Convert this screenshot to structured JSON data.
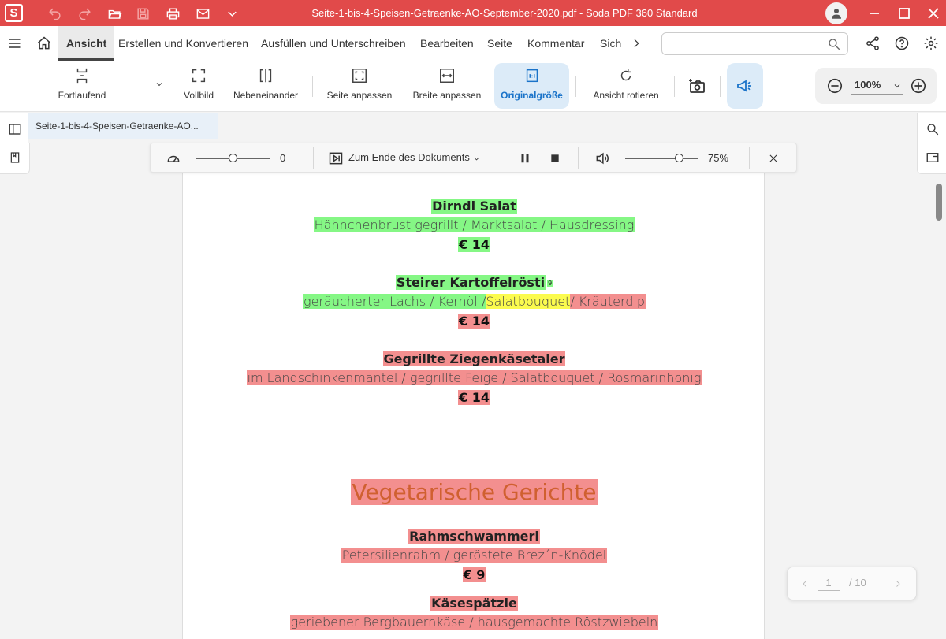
{
  "app": {
    "logo_letter": "S",
    "window_title": "Seite-1-bis-4-Speisen-Getraenke-AO-September-2020.pdf  -  Soda PDF 360 Standard",
    "accent_color": "#e14a4a",
    "quick_icons": [
      "undo-icon",
      "redo-icon",
      "open-folder-icon",
      "save-icon",
      "print-icon",
      "mail-icon",
      "chevron-down-icon"
    ]
  },
  "menu": {
    "items": [
      "Ansicht",
      "Erstellen und Konvertieren",
      "Ausfüllen und Unterschreiben",
      "Bearbeiten",
      "Seite",
      "Kommentar",
      "Sich"
    ],
    "active": "Ansicht",
    "search_placeholder": ""
  },
  "ribbon": {
    "fortlaufend": "Fortlaufend",
    "vollbild": "Vollbild",
    "nebeneinander": "Nebeneinander",
    "seite_anpassen": "Seite anpassen",
    "breite_anpassen": "Breite anpassen",
    "originalgroesse": "Originalgröße",
    "ansicht_rotieren": "Ansicht rotieren",
    "active": "Originalgröße",
    "zoom": "100%"
  },
  "tab": {
    "title": "Seite-1-bis-4-Speisen-Getraenke-AO..."
  },
  "tts": {
    "speed_value": "0",
    "speed_level": 0.5,
    "mode_label": "Zum Ende des Dokuments",
    "volume": "75%",
    "volume_level": 0.75
  },
  "document": {
    "dirndl_title": "Dirndl Salat",
    "dirndl_desc": "Hähnchenbrust gegrillt / Marktsalat / Hausdressing",
    "dirndl_price": "€ 14",
    "steirer_title": "Steirer Kartoffelrösti",
    "steirer_sup": "9",
    "steirer_desc_a": "geräucherter Lachs / Kernöl / ",
    "steirer_desc_b": "Salatbouquet",
    "steirer_desc_c": " / Kräuterdip",
    "steirer_price": "€ 14",
    "ziegen_title": "Gegrillte Ziegenkäsetaler",
    "ziegen_desc": "im Landschinkenmantel / gegrillte Feige / Salatbouquet / Rosmarinhonig",
    "ziegen_price": "€ 14",
    "section_title": "Vegetarische Gerichte",
    "rahm_title": "Rahmschwammerl",
    "rahm_desc": "Petersilienrahm / geröstete Brez´n-Knödel",
    "rahm_price": "€ 9",
    "kaese_title": "Käsespätzle",
    "kaese_desc": "geriebener Bergbauernkäse / hausgemachte Röstzwiebeln"
  },
  "pager": {
    "current": "1",
    "separator": "/ 10"
  }
}
